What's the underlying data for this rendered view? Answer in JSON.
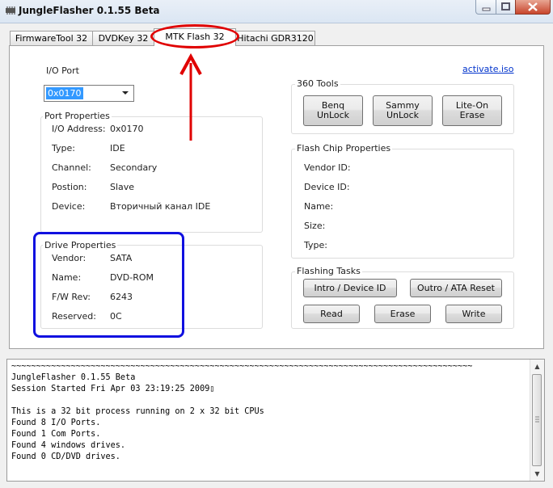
{
  "window": {
    "title": "JungleFlasher 0.1.55 Beta",
    "app_icon": "chip-icon"
  },
  "tabs": [
    {
      "label": "FirmwareTool 32"
    },
    {
      "label": "DVDKey 32"
    },
    {
      "label": "MTK Flash 32",
      "selected": true
    },
    {
      "label": "Hitachi GDR3120"
    }
  ],
  "io_port": {
    "label": "I/O Port",
    "value": "0x0170"
  },
  "activate_link": "activate.iso",
  "port_properties": {
    "title": "Port Properties",
    "rows": [
      {
        "label": "I/O Address:",
        "value": "0x0170"
      },
      {
        "label": "Type:",
        "value": "IDE"
      },
      {
        "label": "Channel:",
        "value": "Secondary"
      },
      {
        "label": "Postion:",
        "value": "Slave"
      },
      {
        "label": "Device:",
        "value": "Вторичный канал IDE"
      }
    ]
  },
  "drive_properties": {
    "title": "Drive Properties",
    "rows": [
      {
        "label": "Vendor:",
        "value": "SATA"
      },
      {
        "label": "Name:",
        "value": "DVD-ROM"
      },
      {
        "label": "F/W Rev:",
        "value": "6243"
      },
      {
        "label": "Reserved:",
        "value": "0C"
      }
    ]
  },
  "tools_360": {
    "title": "360 Tools",
    "buttons": [
      "Benq\nUnLock",
      "Sammy\nUnLock",
      "Lite-On Erase"
    ]
  },
  "flash_chip": {
    "title": "Flash Chip Properties",
    "rows": [
      "Vendor ID:",
      "Device ID:",
      "Name:",
      "Size:",
      "Type:"
    ]
  },
  "flashing_tasks": {
    "title": "Flashing Tasks",
    "buttons": [
      "Intro / Device ID",
      "Outro / ATA Reset",
      "Read",
      "Erase",
      "Write"
    ]
  },
  "log": {
    "lines": [
      "~~~~~~~~~~~~~~~~~~~~~~~~~~~~~~~~~~~~~~~~~~~~~~~~~~~~~~~~~~~~~~~~~~~~~~~~~~~~~~~~~~~~~~~~~~~~~",
      "JungleFlasher 0.1.55 Beta",
      "Session Started Fri Apr 03 23:19:25 2009▯",
      "",
      "This is a 32 bit process running on 2 x 32 bit CPUs",
      "Found 8 I/O Ports.",
      "Found 1 Com Ports.",
      "Found 4 windows drives.",
      "Found 0 CD/DVD drives."
    ]
  },
  "annotation_colors": {
    "ellipse": "#e00000",
    "arrow": "#e00000",
    "box": "#1010e0"
  }
}
